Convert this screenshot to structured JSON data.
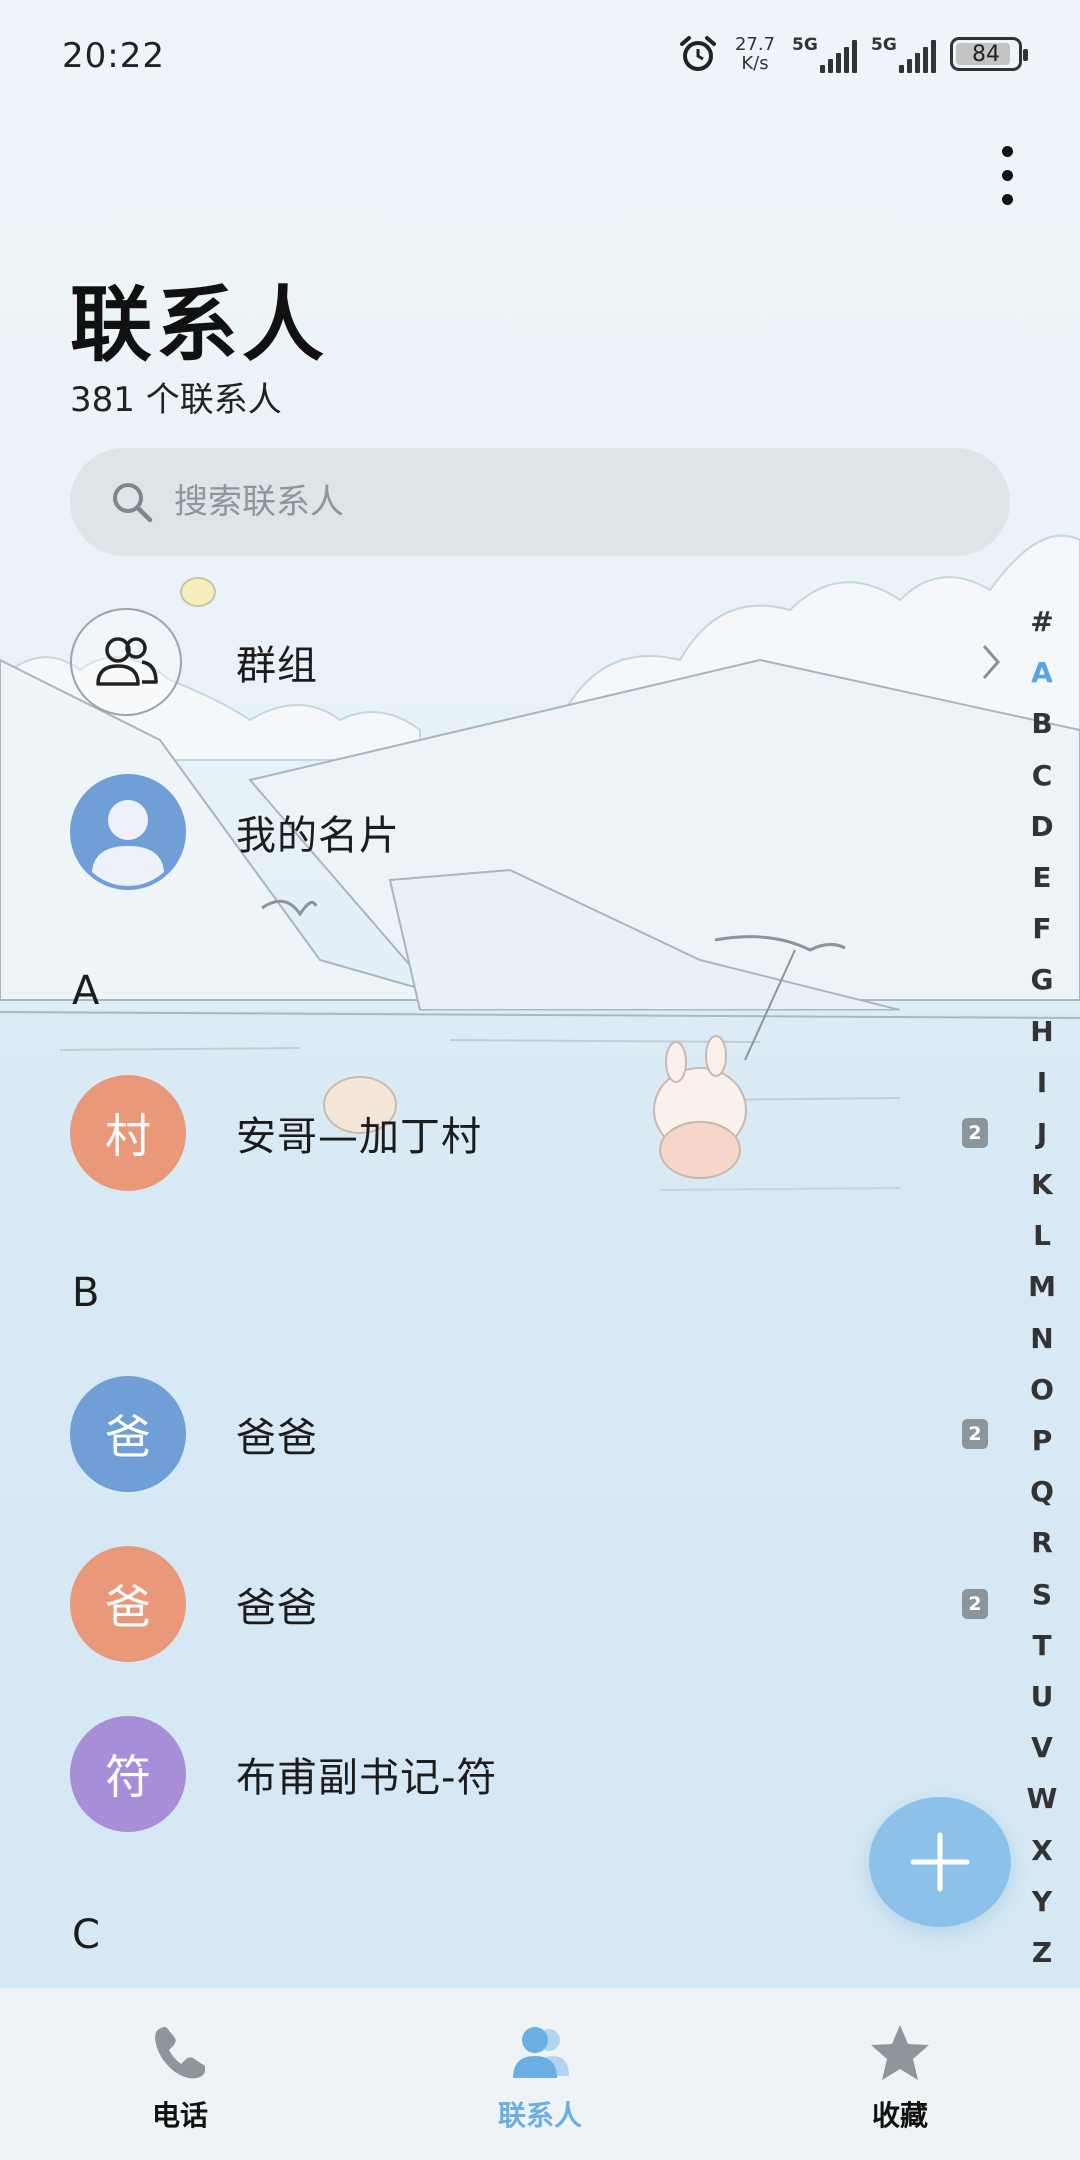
{
  "status_bar": {
    "time": "20:22",
    "net_speed_value": "27.7",
    "net_speed_unit": "K/s",
    "sim1_label": "5G",
    "sim2_label": "5G",
    "battery": "84"
  },
  "header": {
    "title": "联系人",
    "count": "381 个联系人"
  },
  "search": {
    "placeholder": "搜索联系人"
  },
  "fixed_rows": {
    "groups": "群组",
    "my_card": "我的名片"
  },
  "sections": [
    {
      "letter": "A",
      "contacts": [
        {
          "avatar_char": "村",
          "name": "安哥—加丁村",
          "avatar_color": "#e9987a",
          "sim": "2"
        }
      ]
    },
    {
      "letter": "B",
      "contacts": [
        {
          "avatar_char": "爸",
          "name": "爸爸",
          "avatar_color": "#6f9fd6",
          "sim": "2"
        },
        {
          "avatar_char": "爸",
          "name": "爸爸",
          "avatar_color": "#e9987a",
          "sim": "2"
        },
        {
          "avatar_char": "符",
          "name": "布甫副书记-符",
          "avatar_color": "#a68fd8",
          "sim": ""
        }
      ]
    },
    {
      "letter": "C",
      "contacts": []
    }
  ],
  "alpha_index": [
    "#",
    "A",
    "B",
    "C",
    "D",
    "E",
    "F",
    "G",
    "H",
    "I",
    "J",
    "K",
    "L",
    "M",
    "N",
    "O",
    "P",
    "Q",
    "R",
    "S",
    "T",
    "U",
    "V",
    "W",
    "X",
    "Y",
    "Z"
  ],
  "alpha_active": "A",
  "bottom_nav": {
    "phone": "电话",
    "contacts": "联系人",
    "favorites": "收藏"
  },
  "colors": {
    "accent": "#6aaee2",
    "fab": "#8cc2ea",
    "my_card_avatar": "#6f9fd6"
  }
}
